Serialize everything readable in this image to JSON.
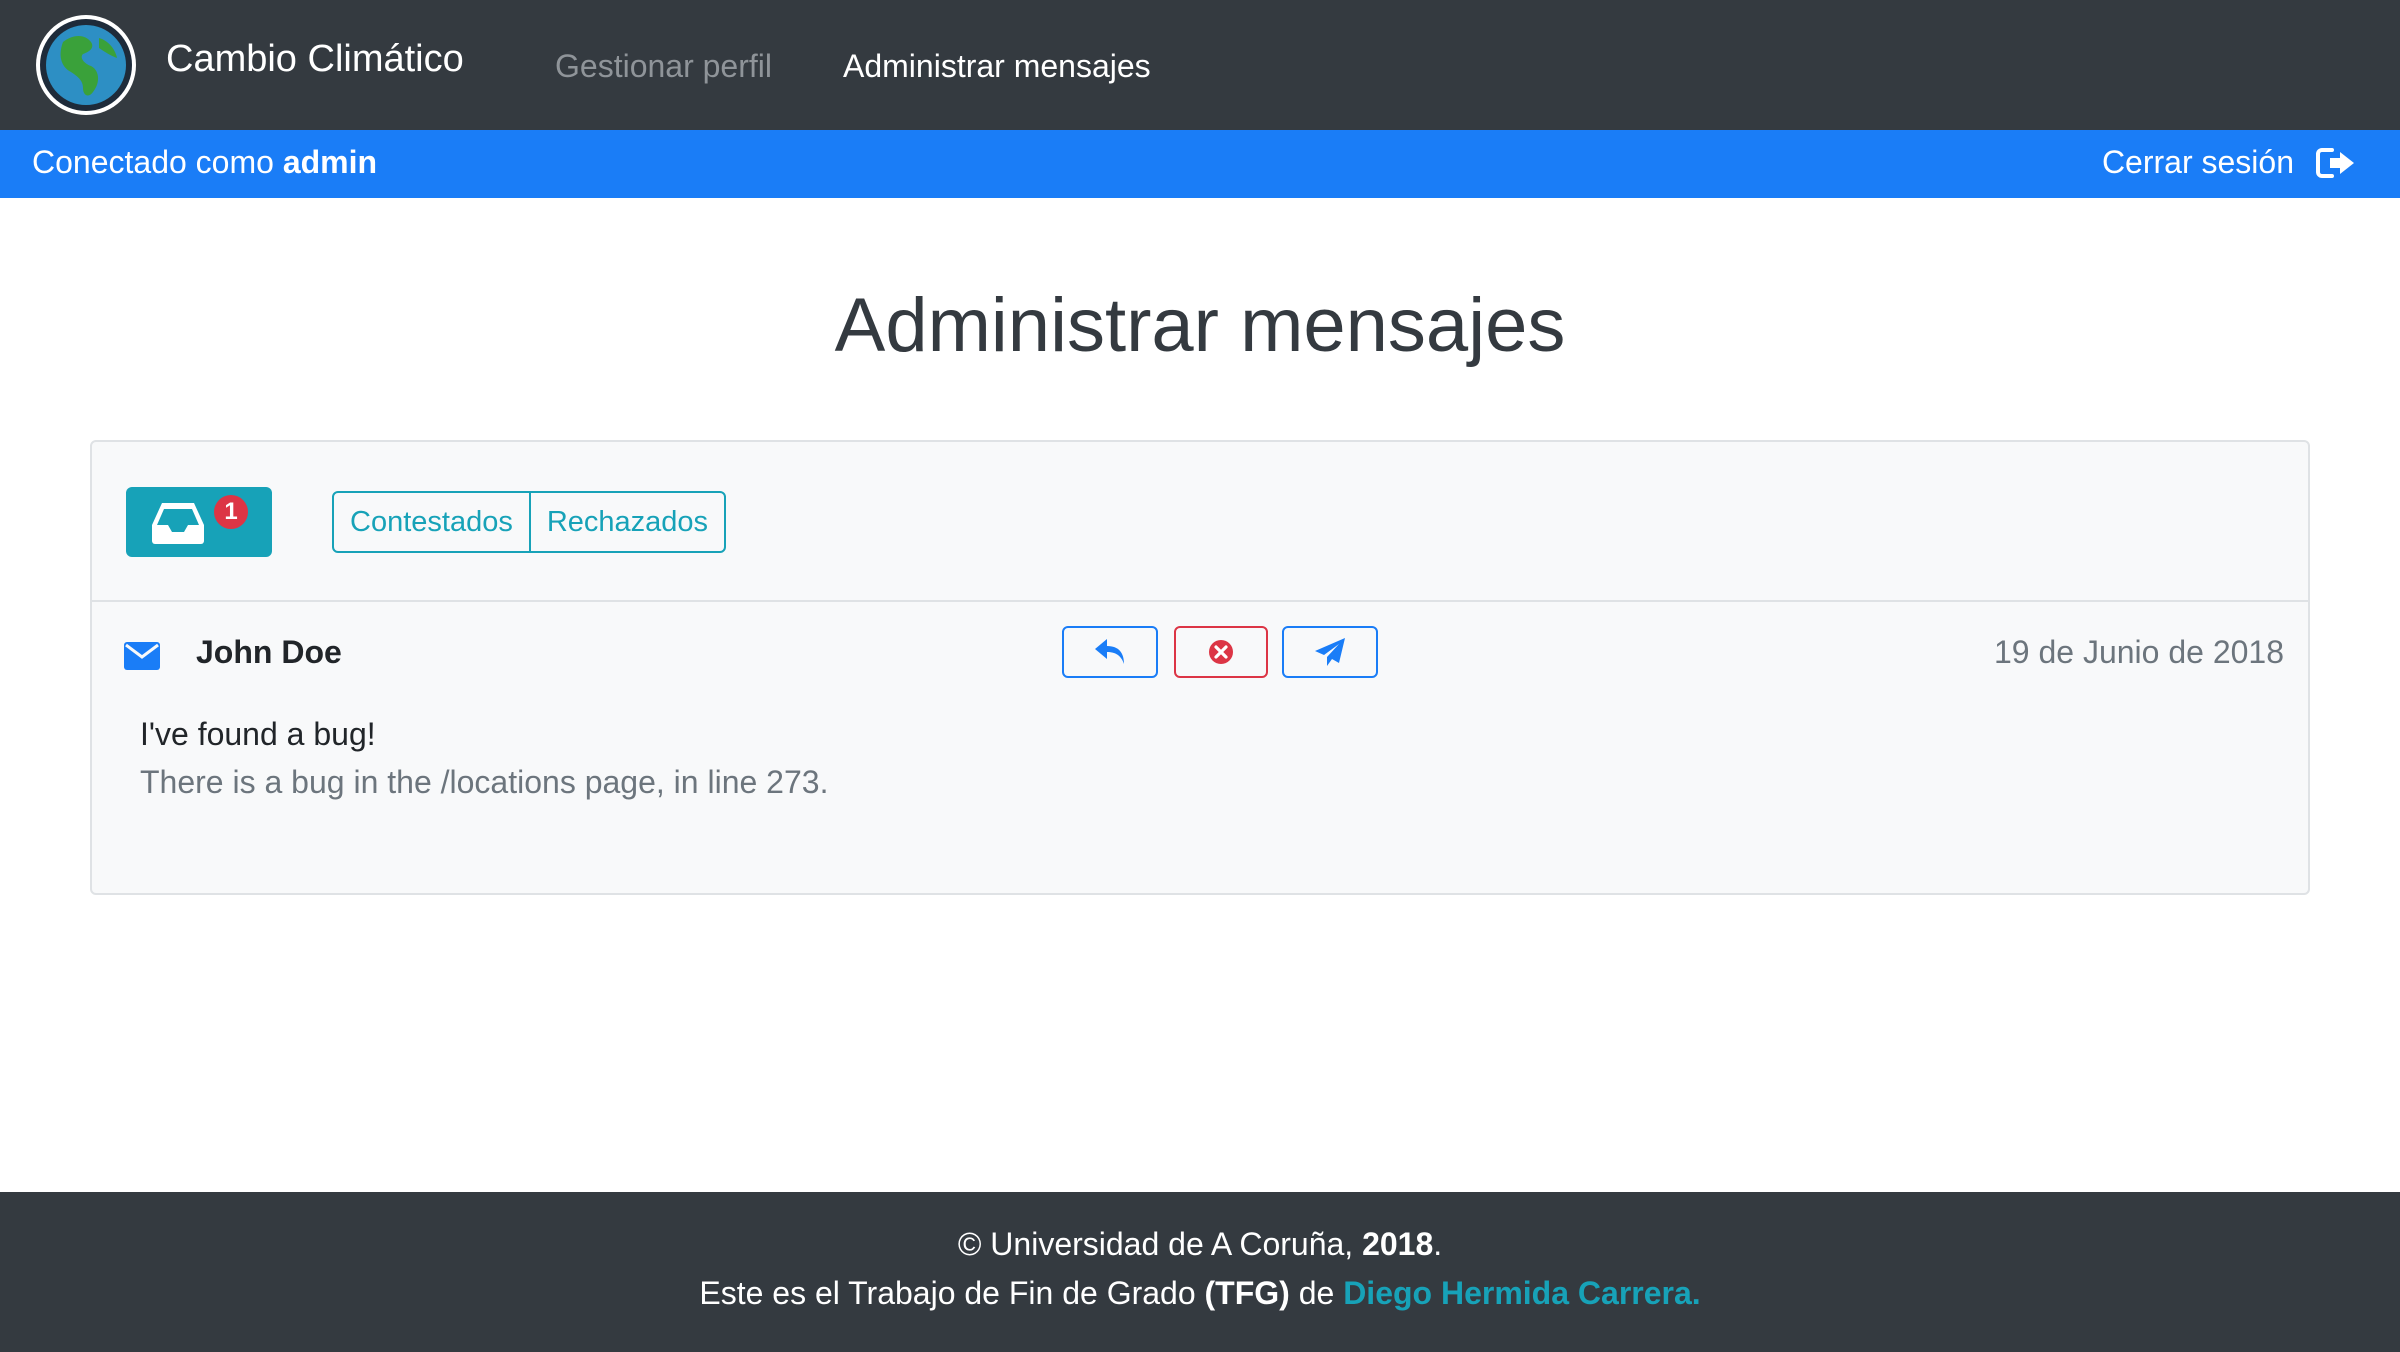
{
  "navbar": {
    "brand": "Cambio Climático",
    "logo_icon": "globe-icon",
    "links": [
      {
        "label": "Gestionar perfil",
        "active": false
      },
      {
        "label": "Administrar mensajes",
        "active": true
      }
    ]
  },
  "session": {
    "prefix": "Conectado como",
    "username": "admin",
    "logout_label": "Cerrar sesión",
    "logout_icon": "sign-out-icon"
  },
  "page": {
    "title": "Administrar mensajes"
  },
  "card": {
    "inbox": {
      "icon": "inbox-icon",
      "badge": "1"
    },
    "filters": [
      "Contestados",
      "Rechazados"
    ],
    "messages": [
      {
        "icon": "envelope-icon",
        "sender": "John Doe",
        "date": "19 de Junio de 2018",
        "subject": "I've found a bug!",
        "body": "There is a bug in the /locations page, in line 273.",
        "actions": [
          "reply-icon",
          "reject-icon",
          "send-icon"
        ]
      }
    ]
  },
  "footer": {
    "copyright": "© Universidad de A Coruña,",
    "year": "2018",
    "period": ".",
    "line2_prefix": "Este es el Trabajo de Fin de Grado",
    "tfg": "(TFG)",
    "de": "de",
    "author": "Diego Hermida Carrera."
  },
  "colors": {
    "navbar": "#343a40",
    "primary": "#1a7df7",
    "info": "#17a2b8",
    "danger": "#dc3545",
    "muted": "#6c757d"
  }
}
